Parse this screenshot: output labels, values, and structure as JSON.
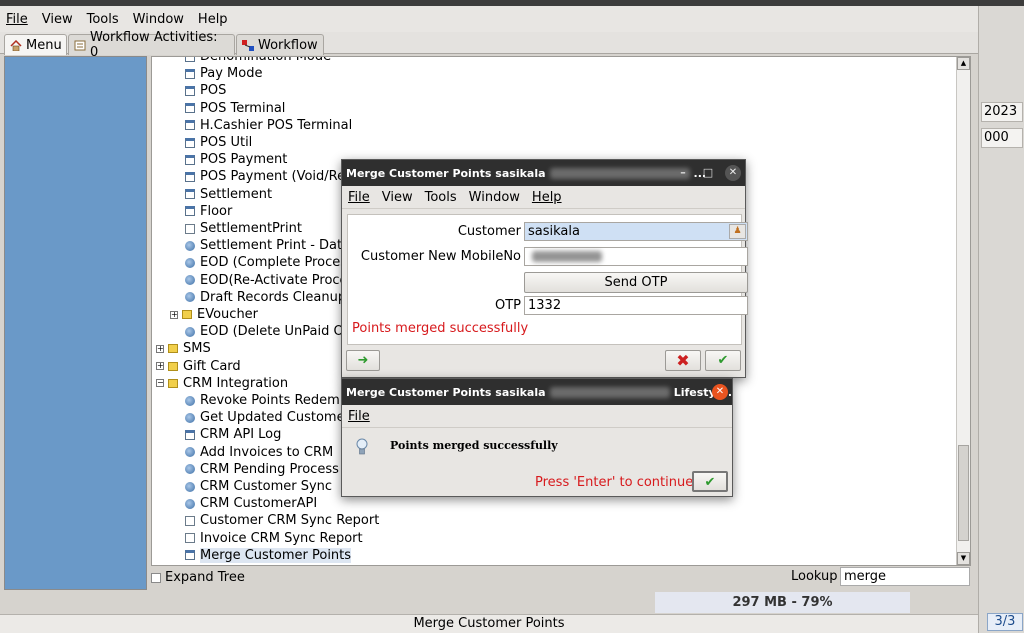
{
  "menubar": {
    "items": [
      "File",
      "View",
      "Tools",
      "Window",
      "Help"
    ]
  },
  "tabs": [
    {
      "label": "Menu"
    },
    {
      "label": "Workflow Activities: 0"
    },
    {
      "label": "Workflow"
    }
  ],
  "tree": {
    "items": [
      {
        "label": "Denomination Mode",
        "icon": "dialog"
      },
      {
        "label": "Pay Mode",
        "icon": "dialog"
      },
      {
        "label": "POS",
        "icon": "dialog"
      },
      {
        "label": "POS Terminal",
        "icon": "dialog"
      },
      {
        "label": "H.Cashier POS Terminal",
        "icon": "dialog"
      },
      {
        "label": "POS Util",
        "icon": "dialog"
      },
      {
        "label": "POS Payment",
        "icon": "dialog"
      },
      {
        "label": "POS Payment (Void/Re",
        "icon": "dialog"
      },
      {
        "label": "Settlement",
        "icon": "dialog"
      },
      {
        "label": "Floor",
        "icon": "dialog"
      },
      {
        "label": "SettlementPrint",
        "icon": "document"
      },
      {
        "label": "Settlement Print - Date",
        "icon": "process"
      },
      {
        "label": "EOD (Complete Process",
        "icon": "process"
      },
      {
        "label": "EOD(Re-Activate Proce",
        "icon": "process"
      },
      {
        "label": "Draft Records Cleanup",
        "icon": "process"
      },
      {
        "label": "EVoucher",
        "icon": "folder"
      },
      {
        "label": "EOD (Delete UnPaid Or",
        "icon": "process"
      },
      {
        "label": "SMS",
        "icon": "folder"
      },
      {
        "label": "Gift Card",
        "icon": "folder"
      },
      {
        "label": "CRM Integration",
        "icon": "folder-open"
      },
      {
        "label": "Revoke Points Redemp",
        "icon": "process"
      },
      {
        "label": "Get Updated Customer",
        "icon": "process"
      },
      {
        "label": "CRM API Log",
        "icon": "dialog"
      },
      {
        "label": "Add Invoices to CRM",
        "icon": "process"
      },
      {
        "label": "CRM Pending Process",
        "icon": "process"
      },
      {
        "label": "CRM Customer Sync",
        "icon": "process"
      },
      {
        "label": "CRM CustomerAPI",
        "icon": "process"
      },
      {
        "label": "Customer CRM Sync Report",
        "icon": "document"
      },
      {
        "label": "Invoice CRM Sync Report",
        "icon": "document"
      },
      {
        "label": "Merge Customer Points",
        "icon": "dialog"
      }
    ]
  },
  "bottom": {
    "expand_tree": "Expand Tree",
    "lookup_label": "Lookup",
    "lookup_value": "merge",
    "memory": "297 MB - 79%"
  },
  "status": {
    "text": "Merge Customer Points",
    "page": "3/3"
  },
  "right_strip": {
    "values": [
      "2023",
      "000"
    ]
  },
  "merge_dialog": {
    "title_prefix": "Merge Customer Points  sasikala",
    "title_suffix": "...",
    "menu": [
      "File",
      "View",
      "Tools",
      "Window",
      "Help"
    ],
    "customer_label": "Customer",
    "customer_value": "sasikala",
    "mobile_label": "Customer New MobileNo",
    "send_otp": "Send OTP",
    "otp_label": "OTP",
    "otp_value": "1332",
    "message": "Points merged successfully"
  },
  "info_dialog": {
    "title_prefix": "Merge Customer Points  sasikala",
    "title_suffix": "Lifestyl...",
    "menu": [
      "File"
    ],
    "message": "Points merged successfully",
    "prompt": "Press 'Enter' to continue"
  },
  "colors": {
    "error": "#d7191c",
    "accent": "#6a99c8",
    "ok": "#2e9a2e"
  }
}
